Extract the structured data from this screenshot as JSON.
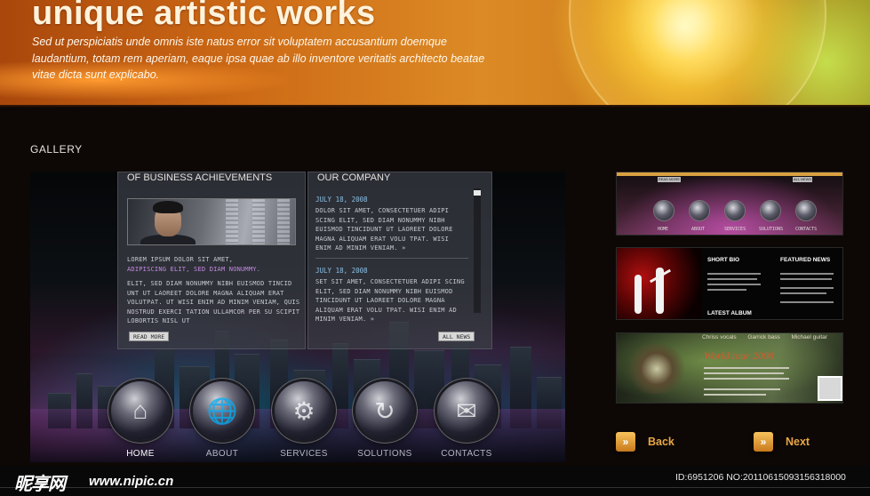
{
  "header": {
    "title": "unique artistic works",
    "description": "Sed ut perspiciatis unde omnis iste natus error sit voluptatem accusantium doemque laudantium, totam rem aperiam, eaque ipsa quae ab illo inventore veritatis architecto beatae vitae dicta sunt explicabo."
  },
  "gallery": {
    "title": "GALLERY",
    "main": {
      "left_panel": {
        "heading": "OF BUSINESS ACHIEVEMENTS",
        "intro_1": "LOREM IPSUM DOLOR SIT AMET,",
        "intro_2": "ADIPISCING ELIT, SED DIAM NONUMMY.",
        "body": "ELIT, SED DIAM NONUMMY NIBH EUISMOD TINCID UNT UT LAOREET DOLORE MAGNA ALIQUAM ERAT VOLUTPAT. UT WISI ENIM AD MINIM VENIAM, QUIS NOSTRUD EXERCI TATION ULLAMCOR PER SU SCIPIT LOBORTIS NISL UT",
        "read_more": "READ MORE"
      },
      "right_panel": {
        "heading": "OUR COMPANY",
        "news": [
          {
            "date": "JULY 18, 2008",
            "text": "DOLOR SIT AMET, CONSECTETUER ADIPI SCING ELIT, SED DIAM NONUMMY NIBH EUISMOD TINCIDUNT UT LAOREET DOLORE MAGNA ALIQUAM ERAT VOLU TPAT. WISI ENIM AD MINIM VENIAM. »"
          },
          {
            "date": "JULY 18, 2008",
            "text": "SET SIT AMET, CONSECTETUER ADIPI SCING ELIT, SED DIAM NONUMMY NIBH EUISMOD TINCIDUNT UT LAOREET DOLORE MAGNA ALIQUAM ERAT VOLU TPAT. WISI ENIM AD MINIM VENIAM. »"
          }
        ],
        "all_news": "ALL NEWS"
      },
      "nav": [
        {
          "label": "HOME",
          "icon": "⌂"
        },
        {
          "label": "ABOUT",
          "icon": "🌐"
        },
        {
          "label": "SERVICES",
          "icon": "⚙"
        },
        {
          "label": "SOLUTIONS",
          "icon": "↻"
        },
        {
          "label": "CONTACTS",
          "icon": "✉"
        }
      ]
    },
    "thumbnails": {
      "t1": {
        "tags": [
          "READ MORE",
          "ALL NEWS"
        ],
        "labels": [
          "HOME",
          "ABOUT",
          "SERVICES",
          "SOLUTIONS",
          "CONTACTS"
        ]
      },
      "t2": {
        "headings": [
          "SHORT BIO",
          "FEATURED NEWS",
          "LATEST ALBUM"
        ]
      },
      "t3": {
        "top_items": [
          "Chriss vocals",
          "Garrick bass",
          "Michael guitar"
        ],
        "title": "World tour 2008"
      }
    },
    "pager": {
      "back": "Back",
      "next": "Next",
      "back_icon": "»",
      "next_icon": "»"
    }
  },
  "watermark": {
    "logo": "昵享网",
    "url": "www.nipic.cn",
    "id": "ID:6951206 NO:20110615093156318000"
  },
  "colors": {
    "header_orange": "#cd6a16",
    "accent_gold": "#e8a645",
    "news_date": "#8ac0e6"
  }
}
